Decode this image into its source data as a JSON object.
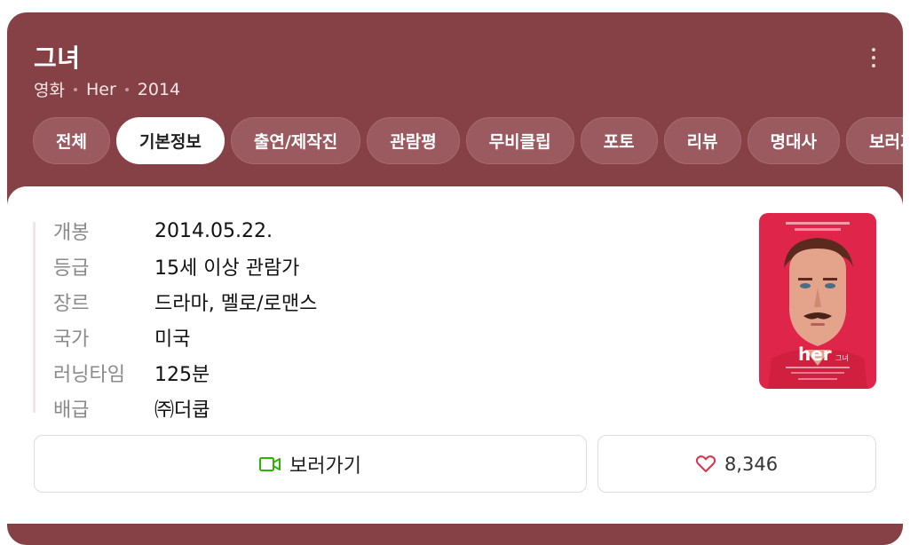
{
  "header": {
    "title": "그녀",
    "meta": [
      "영화",
      "Her",
      "2014"
    ]
  },
  "tabs": [
    {
      "label": "전체",
      "active": false
    },
    {
      "label": "기본정보",
      "active": true
    },
    {
      "label": "출연/제작진",
      "active": false
    },
    {
      "label": "관람평",
      "active": false
    },
    {
      "label": "무비클립",
      "active": false
    },
    {
      "label": "포토",
      "active": false
    },
    {
      "label": "리뷰",
      "active": false
    },
    {
      "label": "명대사",
      "active": false
    },
    {
      "label": "보러가기",
      "active": false
    }
  ],
  "info": [
    {
      "label": "개봉",
      "value": "2014.05.22."
    },
    {
      "label": "등급",
      "value": "15세 이상 관람가"
    },
    {
      "label": "장르",
      "value": "드라마, 멜로/로맨스"
    },
    {
      "label": "국가",
      "value": "미국"
    },
    {
      "label": "러닝타임",
      "value": "125분"
    },
    {
      "label": "배급",
      "value": "㈜더쿱"
    }
  ],
  "poster": {
    "title_text": "her",
    "subtitle_text": "그녀"
  },
  "actions": {
    "watch_label": "보러가기",
    "like_count": "8,346"
  },
  "colors": {
    "header_bg": "#864146",
    "tab_bg": "#9a5a5f",
    "poster_bg": "#e0254a",
    "watch_icon": "#2db400",
    "like_icon": "#d9344f"
  },
  "icons": {
    "more": "more-vertical-icon",
    "watch": "video-camera-icon",
    "like": "heart-icon"
  }
}
